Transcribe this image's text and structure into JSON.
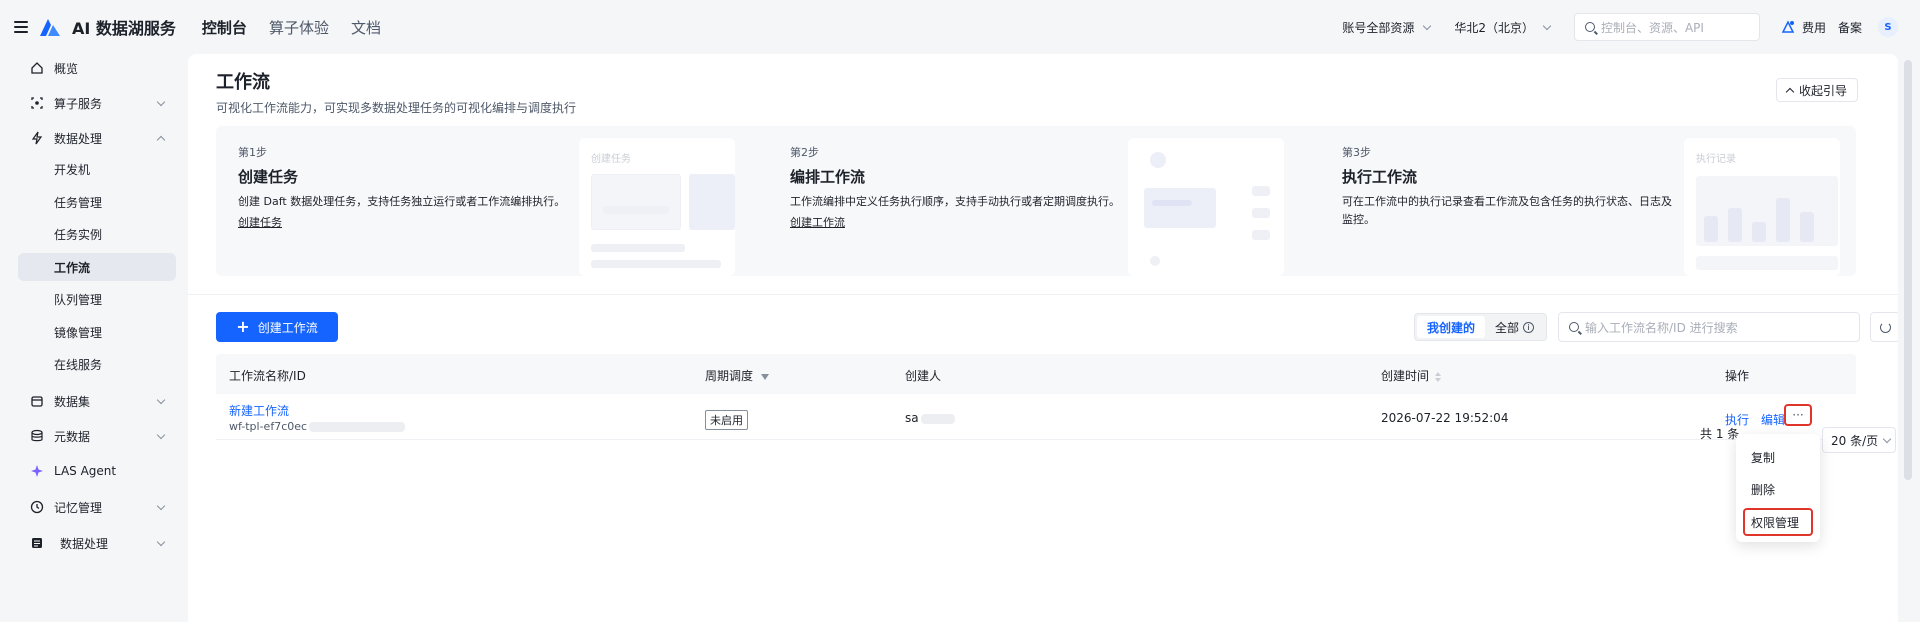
{
  "topbar": {
    "brand": "AI 数据湖服务",
    "nav": [
      "控制台",
      "算子体验",
      "文档"
    ],
    "account_scope": "账号全部资源",
    "region": "华北2（北京）",
    "search_placeholder": "控制台、资源、API",
    "fee": "费用",
    "record": "备案",
    "avatar": "S"
  },
  "sidebar": {
    "items": [
      {
        "label": "概览",
        "icon": "home-icon"
      },
      {
        "label": "算子服务",
        "icon": "operator-icon"
      },
      {
        "label": "数据处理",
        "icon": "lightning-icon"
      },
      {
        "label": "开发机"
      },
      {
        "label": "任务管理"
      },
      {
        "label": "任务实例"
      },
      {
        "label": "工作流"
      },
      {
        "label": "队列管理"
      },
      {
        "label": "镜像管理"
      },
      {
        "label": "在线服务"
      },
      {
        "label": "数据集",
        "icon": "dataset-icon"
      },
      {
        "label": "元数据",
        "icon": "database-icon"
      },
      {
        "label": "LAS Agent",
        "icon": "sparkle-icon"
      },
      {
        "label": "记忆管理",
        "icon": "memory-icon"
      },
      {
        "label": "数据处理",
        "icon": "table-icon"
      }
    ]
  },
  "page": {
    "title": "工作流",
    "description": "可视化工作流能力，可实现多数据处理任务的可视化编排与调度执行",
    "collapse_label": "收起引导"
  },
  "guide": {
    "steps": [
      {
        "no": "第1步",
        "title": "创建任务",
        "desc": "创建 Daft 数据处理任务，支持任务独立运行或者工作流编排执行。",
        "link": "创建任务",
        "illus_caption": "创建任务"
      },
      {
        "no": "第2步",
        "title": "编排工作流",
        "desc": "工作流编排中定义任务执行顺序，支持手动执行或者定期调度执行。",
        "link": "创建工作流",
        "illus_caption": ""
      },
      {
        "no": "第3步",
        "title": "执行工作流",
        "desc": "可在工作流中的执行记录查看工作流及包含任务的执行状态、日志及监控。",
        "link": "",
        "illus_caption": "执行记录"
      }
    ]
  },
  "toolbar": {
    "create_label": "创建工作流",
    "filter_mine": "我创建的",
    "filter_all": "全部",
    "search_placeholder": "输入工作流名称/ID 进行搜索"
  },
  "table": {
    "headers": {
      "name": "工作流名称/ID",
      "schedule": "周期调度",
      "creator": "创建人",
      "created_at": "创建时间",
      "ops": "操作"
    },
    "rows": [
      {
        "name": "新建工作流",
        "id": "wf-tpl-ef7c0ec",
        "schedule": "未启用",
        "creator": "sa",
        "created_at": "2026-07-22 19:52:04",
        "op_run": "执行",
        "op_edit": "编辑",
        "op_more": "···"
      }
    ]
  },
  "pagination": {
    "total": "共 1 条",
    "page_size": "20 条/页"
  },
  "more_menu": {
    "items": [
      "复制",
      "删除",
      "权限管理"
    ]
  },
  "colors": {
    "primary": "#1664ff",
    "highlight": "#e0352b"
  }
}
